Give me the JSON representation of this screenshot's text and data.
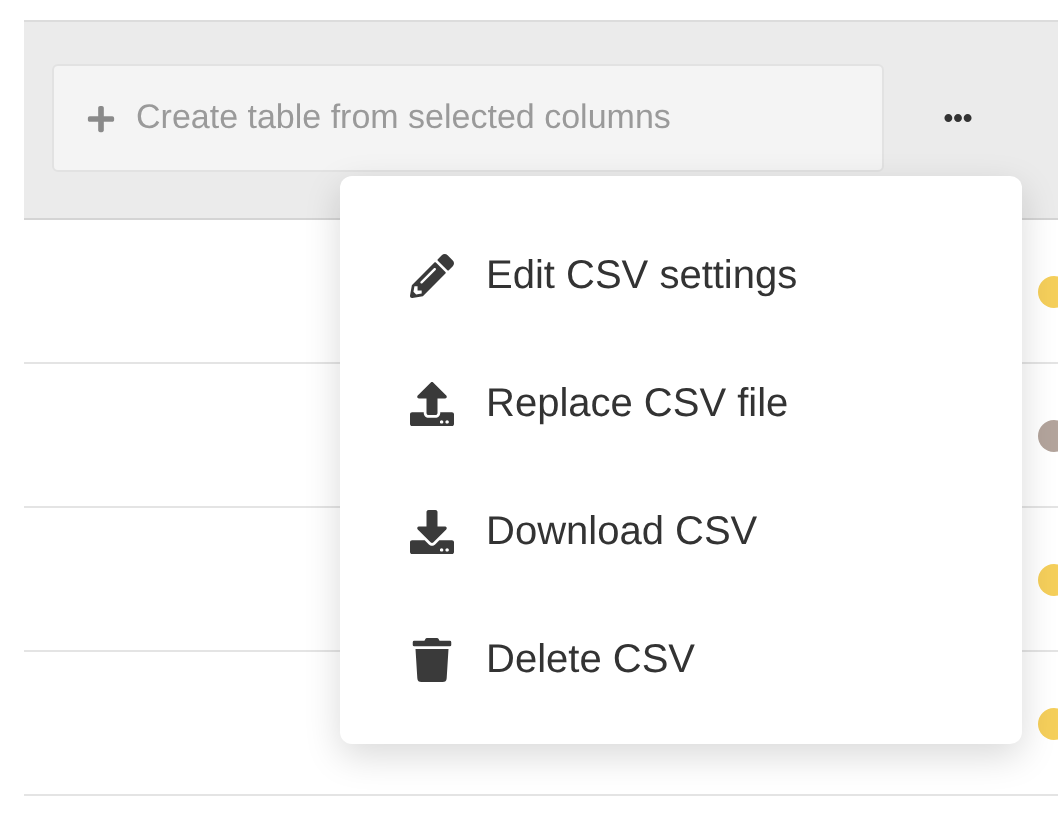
{
  "toolbar": {
    "create_button": {
      "label": "Create table from selected columns"
    }
  },
  "rows": [
    {
      "color": "#f5cf5b"
    },
    {
      "color": "#b3a49c"
    },
    {
      "color": "#f5cf5b"
    },
    {
      "color": "#f5cf5b"
    }
  ],
  "menu": {
    "items": [
      {
        "label": "Edit CSV settings"
      },
      {
        "label": "Replace CSV file"
      },
      {
        "label": "Download CSV"
      },
      {
        "label": "Delete CSV"
      }
    ]
  }
}
